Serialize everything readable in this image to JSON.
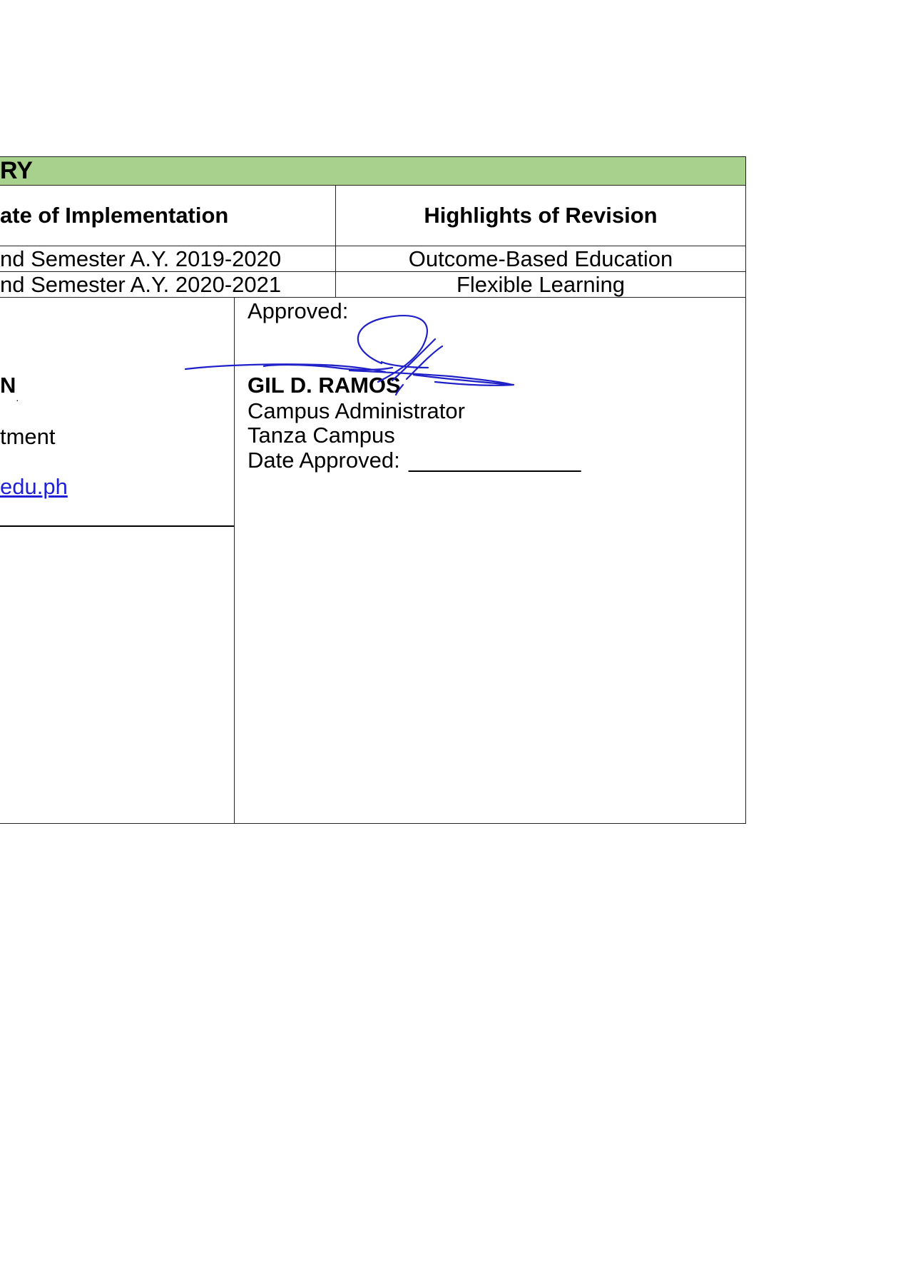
{
  "table_title": "RY",
  "revision_table": {
    "headers": [
      "ate of Implementation",
      "Highlights of Revision"
    ],
    "rows": [
      [
        "nd Semester A.Y. 2019-2020",
        "Outcome-Based Education"
      ],
      [
        "nd Semester A.Y. 2020-2021",
        "Flexible Learning"
      ]
    ]
  },
  "left_block": {
    "name_fragment": "N",
    "dot": "·",
    "department_fragment": "tment",
    "email_fragment": "edu.ph",
    "underline": "___________________"
  },
  "approval": {
    "label": "Approved:",
    "name": "GIL D. RAMOS",
    "position": "Campus Administrator",
    "campus": "Tanza Campus",
    "date_label": "Date Approved:",
    "date_blank": "______________"
  },
  "colors": {
    "title_band": "#a9d18e",
    "signature_ink": "#2020c8",
    "link": "#1f1fd8"
  }
}
